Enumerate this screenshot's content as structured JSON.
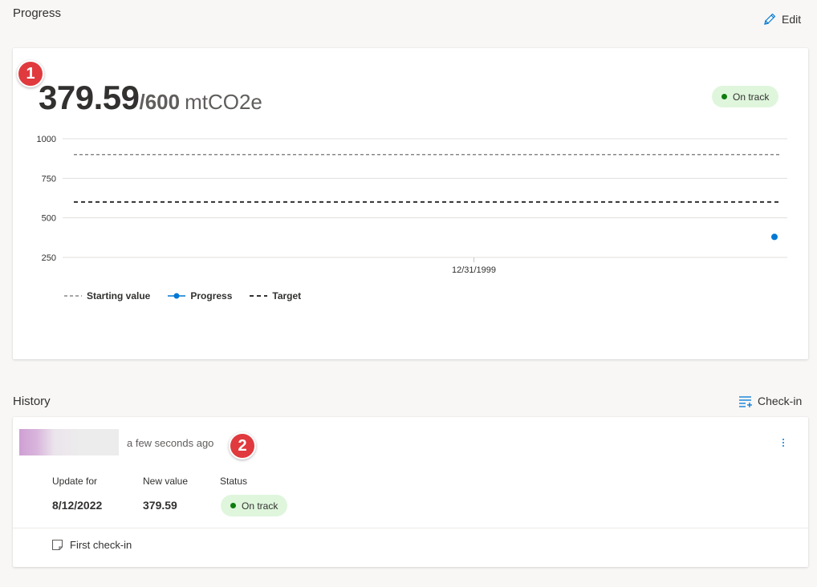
{
  "progress_section": {
    "title": "Progress",
    "edit_label": "Edit",
    "callout_number": "1",
    "current_value": "379.59",
    "separator": "/",
    "target_value": "600",
    "unit": "mtCO2e",
    "status": "On track",
    "status_color": "#107c10"
  },
  "chart_data": {
    "type": "line",
    "y_ticks": [
      "1000",
      "750",
      "500",
      "250"
    ],
    "ylim": [
      250,
      1000
    ],
    "x_tick_labels": [
      "12/31/1999"
    ],
    "series": [
      {
        "name": "Starting value",
        "values": [
          900
        ],
        "style": "dashed",
        "color": "#8a8886"
      },
      {
        "name": "Progress",
        "values": [
          379.59
        ],
        "style": "marker",
        "color": "#0078d4"
      },
      {
        "name": "Target",
        "values": [
          600
        ],
        "style": "dashed",
        "color": "#323130"
      }
    ],
    "grid": true,
    "legend_position": "bottom-left"
  },
  "history_section": {
    "title": "History",
    "checkin_label": "Check-in",
    "callout_number": "2",
    "entry": {
      "timestamp": "a few seconds ago",
      "update_for_label": "Update for",
      "update_for_value": "8/12/2022",
      "new_value_label": "New value",
      "new_value": "379.59",
      "status_label": "Status",
      "status": "On track"
    },
    "footer_note": "First check-in"
  }
}
